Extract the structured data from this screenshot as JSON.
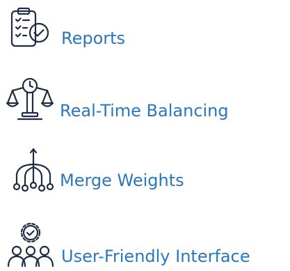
{
  "features": [
    {
      "label": "Reports",
      "icon": "clipboard-check-icon"
    },
    {
      "label": "Real-Time Balancing",
      "icon": "scale-clock-icon"
    },
    {
      "label": "Merge Weights",
      "icon": "merge-hierarchy-icon"
    },
    {
      "label": "User-Friendly Interface",
      "icon": "users-gear-icon"
    }
  ],
  "colors": {
    "text": "#2b77be",
    "icon": "#1f2a44",
    "background": "#ffffff"
  }
}
